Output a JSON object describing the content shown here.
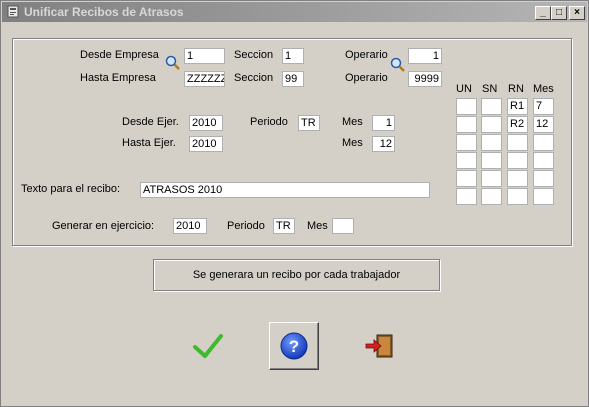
{
  "window": {
    "title": "Unificar Recibos de Atrasos",
    "buttons": {
      "minimize": "_",
      "maximize": "□",
      "close": "×"
    }
  },
  "filters": {
    "desde_empresa_label": "Desde Empresa",
    "desde_empresa_value": "1",
    "hasta_empresa_label": "Hasta Empresa",
    "hasta_empresa_value": "ZZZZZZ",
    "seccion_label": "Seccion",
    "desde_seccion_value": "1",
    "hasta_seccion_value": "99",
    "operario_label": "Operario",
    "desde_operario_value": "1",
    "hasta_operario_value": "9999",
    "desde_ejer_label": "Desde Ejer.",
    "desde_ejer_value": "2010",
    "hasta_ejer_label": "Hasta Ejer.",
    "hasta_ejer_value": "2010",
    "periodo_label": "Periodo",
    "periodo_value": "TR",
    "mes_label": "Mes",
    "desde_mes_value": "1",
    "hasta_mes_value": "12",
    "texto_label": "Texto para el recibo:",
    "texto_value": "ATRASOS 2010",
    "generar_label": "Generar en ejercicio:",
    "generar_value": "2010",
    "generar_periodo_label": "Periodo",
    "generar_periodo_value": "TR",
    "generar_mes_label": "Mes",
    "generar_mes_value": ""
  },
  "grid": {
    "headers": [
      "UN",
      "SN",
      "RN",
      "Mes"
    ],
    "rows": [
      [
        "",
        "",
        "R1",
        "7"
      ],
      [
        "",
        "",
        "R2",
        "12"
      ],
      [
        "",
        "",
        "",
        ""
      ],
      [
        "",
        "",
        "",
        ""
      ],
      [
        "",
        "",
        "",
        ""
      ],
      [
        "",
        "",
        "",
        ""
      ]
    ]
  },
  "message": "Se generara un recibo por cada trabajador",
  "actions": {
    "accept_icon": "check-icon",
    "help_icon": "help-icon",
    "exit_icon": "exit-door-icon"
  },
  "colors": {
    "accent_help": "#1e4fd8",
    "check": "#3dbb2c",
    "exit_arrow": "#d02020"
  }
}
